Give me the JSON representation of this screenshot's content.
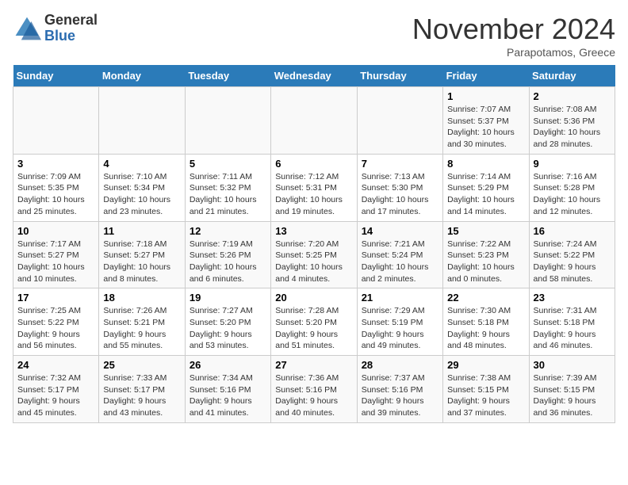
{
  "logo": {
    "line1": "General",
    "line2": "Blue"
  },
  "title": "November 2024",
  "subtitle": "Parapotamos, Greece",
  "weekdays": [
    "Sunday",
    "Monday",
    "Tuesday",
    "Wednesday",
    "Thursday",
    "Friday",
    "Saturday"
  ],
  "weeks": [
    [
      {
        "day": "",
        "info": ""
      },
      {
        "day": "",
        "info": ""
      },
      {
        "day": "",
        "info": ""
      },
      {
        "day": "",
        "info": ""
      },
      {
        "day": "",
        "info": ""
      },
      {
        "day": "1",
        "info": "Sunrise: 7:07 AM\nSunset: 5:37 PM\nDaylight: 10 hours\nand 30 minutes."
      },
      {
        "day": "2",
        "info": "Sunrise: 7:08 AM\nSunset: 5:36 PM\nDaylight: 10 hours\nand 28 minutes."
      }
    ],
    [
      {
        "day": "3",
        "info": "Sunrise: 7:09 AM\nSunset: 5:35 PM\nDaylight: 10 hours\nand 25 minutes."
      },
      {
        "day": "4",
        "info": "Sunrise: 7:10 AM\nSunset: 5:34 PM\nDaylight: 10 hours\nand 23 minutes."
      },
      {
        "day": "5",
        "info": "Sunrise: 7:11 AM\nSunset: 5:32 PM\nDaylight: 10 hours\nand 21 minutes."
      },
      {
        "day": "6",
        "info": "Sunrise: 7:12 AM\nSunset: 5:31 PM\nDaylight: 10 hours\nand 19 minutes."
      },
      {
        "day": "7",
        "info": "Sunrise: 7:13 AM\nSunset: 5:30 PM\nDaylight: 10 hours\nand 17 minutes."
      },
      {
        "day": "8",
        "info": "Sunrise: 7:14 AM\nSunset: 5:29 PM\nDaylight: 10 hours\nand 14 minutes."
      },
      {
        "day": "9",
        "info": "Sunrise: 7:16 AM\nSunset: 5:28 PM\nDaylight: 10 hours\nand 12 minutes."
      }
    ],
    [
      {
        "day": "10",
        "info": "Sunrise: 7:17 AM\nSunset: 5:27 PM\nDaylight: 10 hours\nand 10 minutes."
      },
      {
        "day": "11",
        "info": "Sunrise: 7:18 AM\nSunset: 5:27 PM\nDaylight: 10 hours\nand 8 minutes."
      },
      {
        "day": "12",
        "info": "Sunrise: 7:19 AM\nSunset: 5:26 PM\nDaylight: 10 hours\nand 6 minutes."
      },
      {
        "day": "13",
        "info": "Sunrise: 7:20 AM\nSunset: 5:25 PM\nDaylight: 10 hours\nand 4 minutes."
      },
      {
        "day": "14",
        "info": "Sunrise: 7:21 AM\nSunset: 5:24 PM\nDaylight: 10 hours\nand 2 minutes."
      },
      {
        "day": "15",
        "info": "Sunrise: 7:22 AM\nSunset: 5:23 PM\nDaylight: 10 hours\nand 0 minutes."
      },
      {
        "day": "16",
        "info": "Sunrise: 7:24 AM\nSunset: 5:22 PM\nDaylight: 9 hours\nand 58 minutes."
      }
    ],
    [
      {
        "day": "17",
        "info": "Sunrise: 7:25 AM\nSunset: 5:22 PM\nDaylight: 9 hours\nand 56 minutes."
      },
      {
        "day": "18",
        "info": "Sunrise: 7:26 AM\nSunset: 5:21 PM\nDaylight: 9 hours\nand 55 minutes."
      },
      {
        "day": "19",
        "info": "Sunrise: 7:27 AM\nSunset: 5:20 PM\nDaylight: 9 hours\nand 53 minutes."
      },
      {
        "day": "20",
        "info": "Sunrise: 7:28 AM\nSunset: 5:20 PM\nDaylight: 9 hours\nand 51 minutes."
      },
      {
        "day": "21",
        "info": "Sunrise: 7:29 AM\nSunset: 5:19 PM\nDaylight: 9 hours\nand 49 minutes."
      },
      {
        "day": "22",
        "info": "Sunrise: 7:30 AM\nSunset: 5:18 PM\nDaylight: 9 hours\nand 48 minutes."
      },
      {
        "day": "23",
        "info": "Sunrise: 7:31 AM\nSunset: 5:18 PM\nDaylight: 9 hours\nand 46 minutes."
      }
    ],
    [
      {
        "day": "24",
        "info": "Sunrise: 7:32 AM\nSunset: 5:17 PM\nDaylight: 9 hours\nand 45 minutes."
      },
      {
        "day": "25",
        "info": "Sunrise: 7:33 AM\nSunset: 5:17 PM\nDaylight: 9 hours\nand 43 minutes."
      },
      {
        "day": "26",
        "info": "Sunrise: 7:34 AM\nSunset: 5:16 PM\nDaylight: 9 hours\nand 41 minutes."
      },
      {
        "day": "27",
        "info": "Sunrise: 7:36 AM\nSunset: 5:16 PM\nDaylight: 9 hours\nand 40 minutes."
      },
      {
        "day": "28",
        "info": "Sunrise: 7:37 AM\nSunset: 5:16 PM\nDaylight: 9 hours\nand 39 minutes."
      },
      {
        "day": "29",
        "info": "Sunrise: 7:38 AM\nSunset: 5:15 PM\nDaylight: 9 hours\nand 37 minutes."
      },
      {
        "day": "30",
        "info": "Sunrise: 7:39 AM\nSunset: 5:15 PM\nDaylight: 9 hours\nand 36 minutes."
      }
    ]
  ]
}
